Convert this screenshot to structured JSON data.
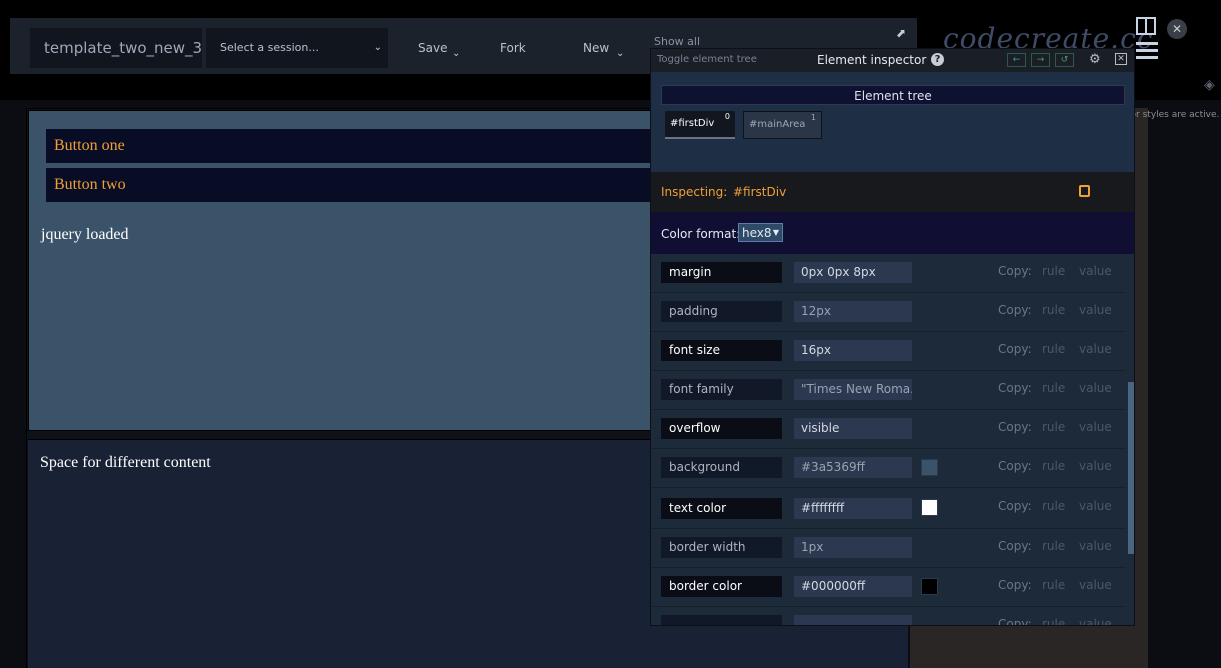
{
  "toolbar": {
    "project_title": "template_two_new_3",
    "session_placeholder": "Select a session...",
    "save_label": "Save",
    "fork_label": "Fork",
    "new_label": "New",
    "show_all_label": "Show all"
  },
  "brand": {
    "logo_text": "codecreate.cc"
  },
  "preview": {
    "button_one": "Button one",
    "button_two": "Button two",
    "jquery_text": "jquery loaded",
    "main_area_text": "Space for different content",
    "hint_text": "tor styles are active."
  },
  "inspector": {
    "toggle_tree_label": "Toggle element tree",
    "title": "Element inspector",
    "tree_header": "Element tree",
    "tree_nodes": [
      {
        "label": "#firstDiv",
        "index": "0"
      },
      {
        "label": "#mainArea",
        "index": "1"
      }
    ],
    "inspecting_label": "Inspecting:",
    "inspecting_value": "#firstDiv",
    "color_format_label": "Color format:",
    "color_format_value": "hex8",
    "copy_label": "Copy:",
    "rule_label": "rule",
    "value_label": "value",
    "properties": [
      {
        "name": "margin",
        "value": "0px 0px 8px"
      },
      {
        "name": "padding",
        "value": "12px"
      },
      {
        "name": "font size",
        "value": "16px"
      },
      {
        "name": "font family",
        "value": "\"Times New Roma..."
      },
      {
        "name": "overflow",
        "value": "visible"
      },
      {
        "name": "background",
        "value": "#3a5369ff"
      },
      {
        "name": "text color",
        "value": "#ffffffff"
      },
      {
        "name": "border width",
        "value": "1px"
      },
      {
        "name": "border color",
        "value": "#000000ff"
      },
      {
        "name": "",
        "value": ""
      }
    ]
  },
  "colors": {
    "accent_orange": "#f0a035",
    "first_div_bg": "#3a5369",
    "main_area_bg": "#182234",
    "swatch_background": "#3a5369",
    "swatch_text": "#ffffff",
    "swatch_border": "#000000"
  },
  "icons": {
    "expand": "expand-icon",
    "layout": "layout-icon",
    "menu": "menu-icon",
    "close": "close-icon",
    "help": "help-icon",
    "gear": "gear-icon",
    "copy": "copy-icon"
  }
}
